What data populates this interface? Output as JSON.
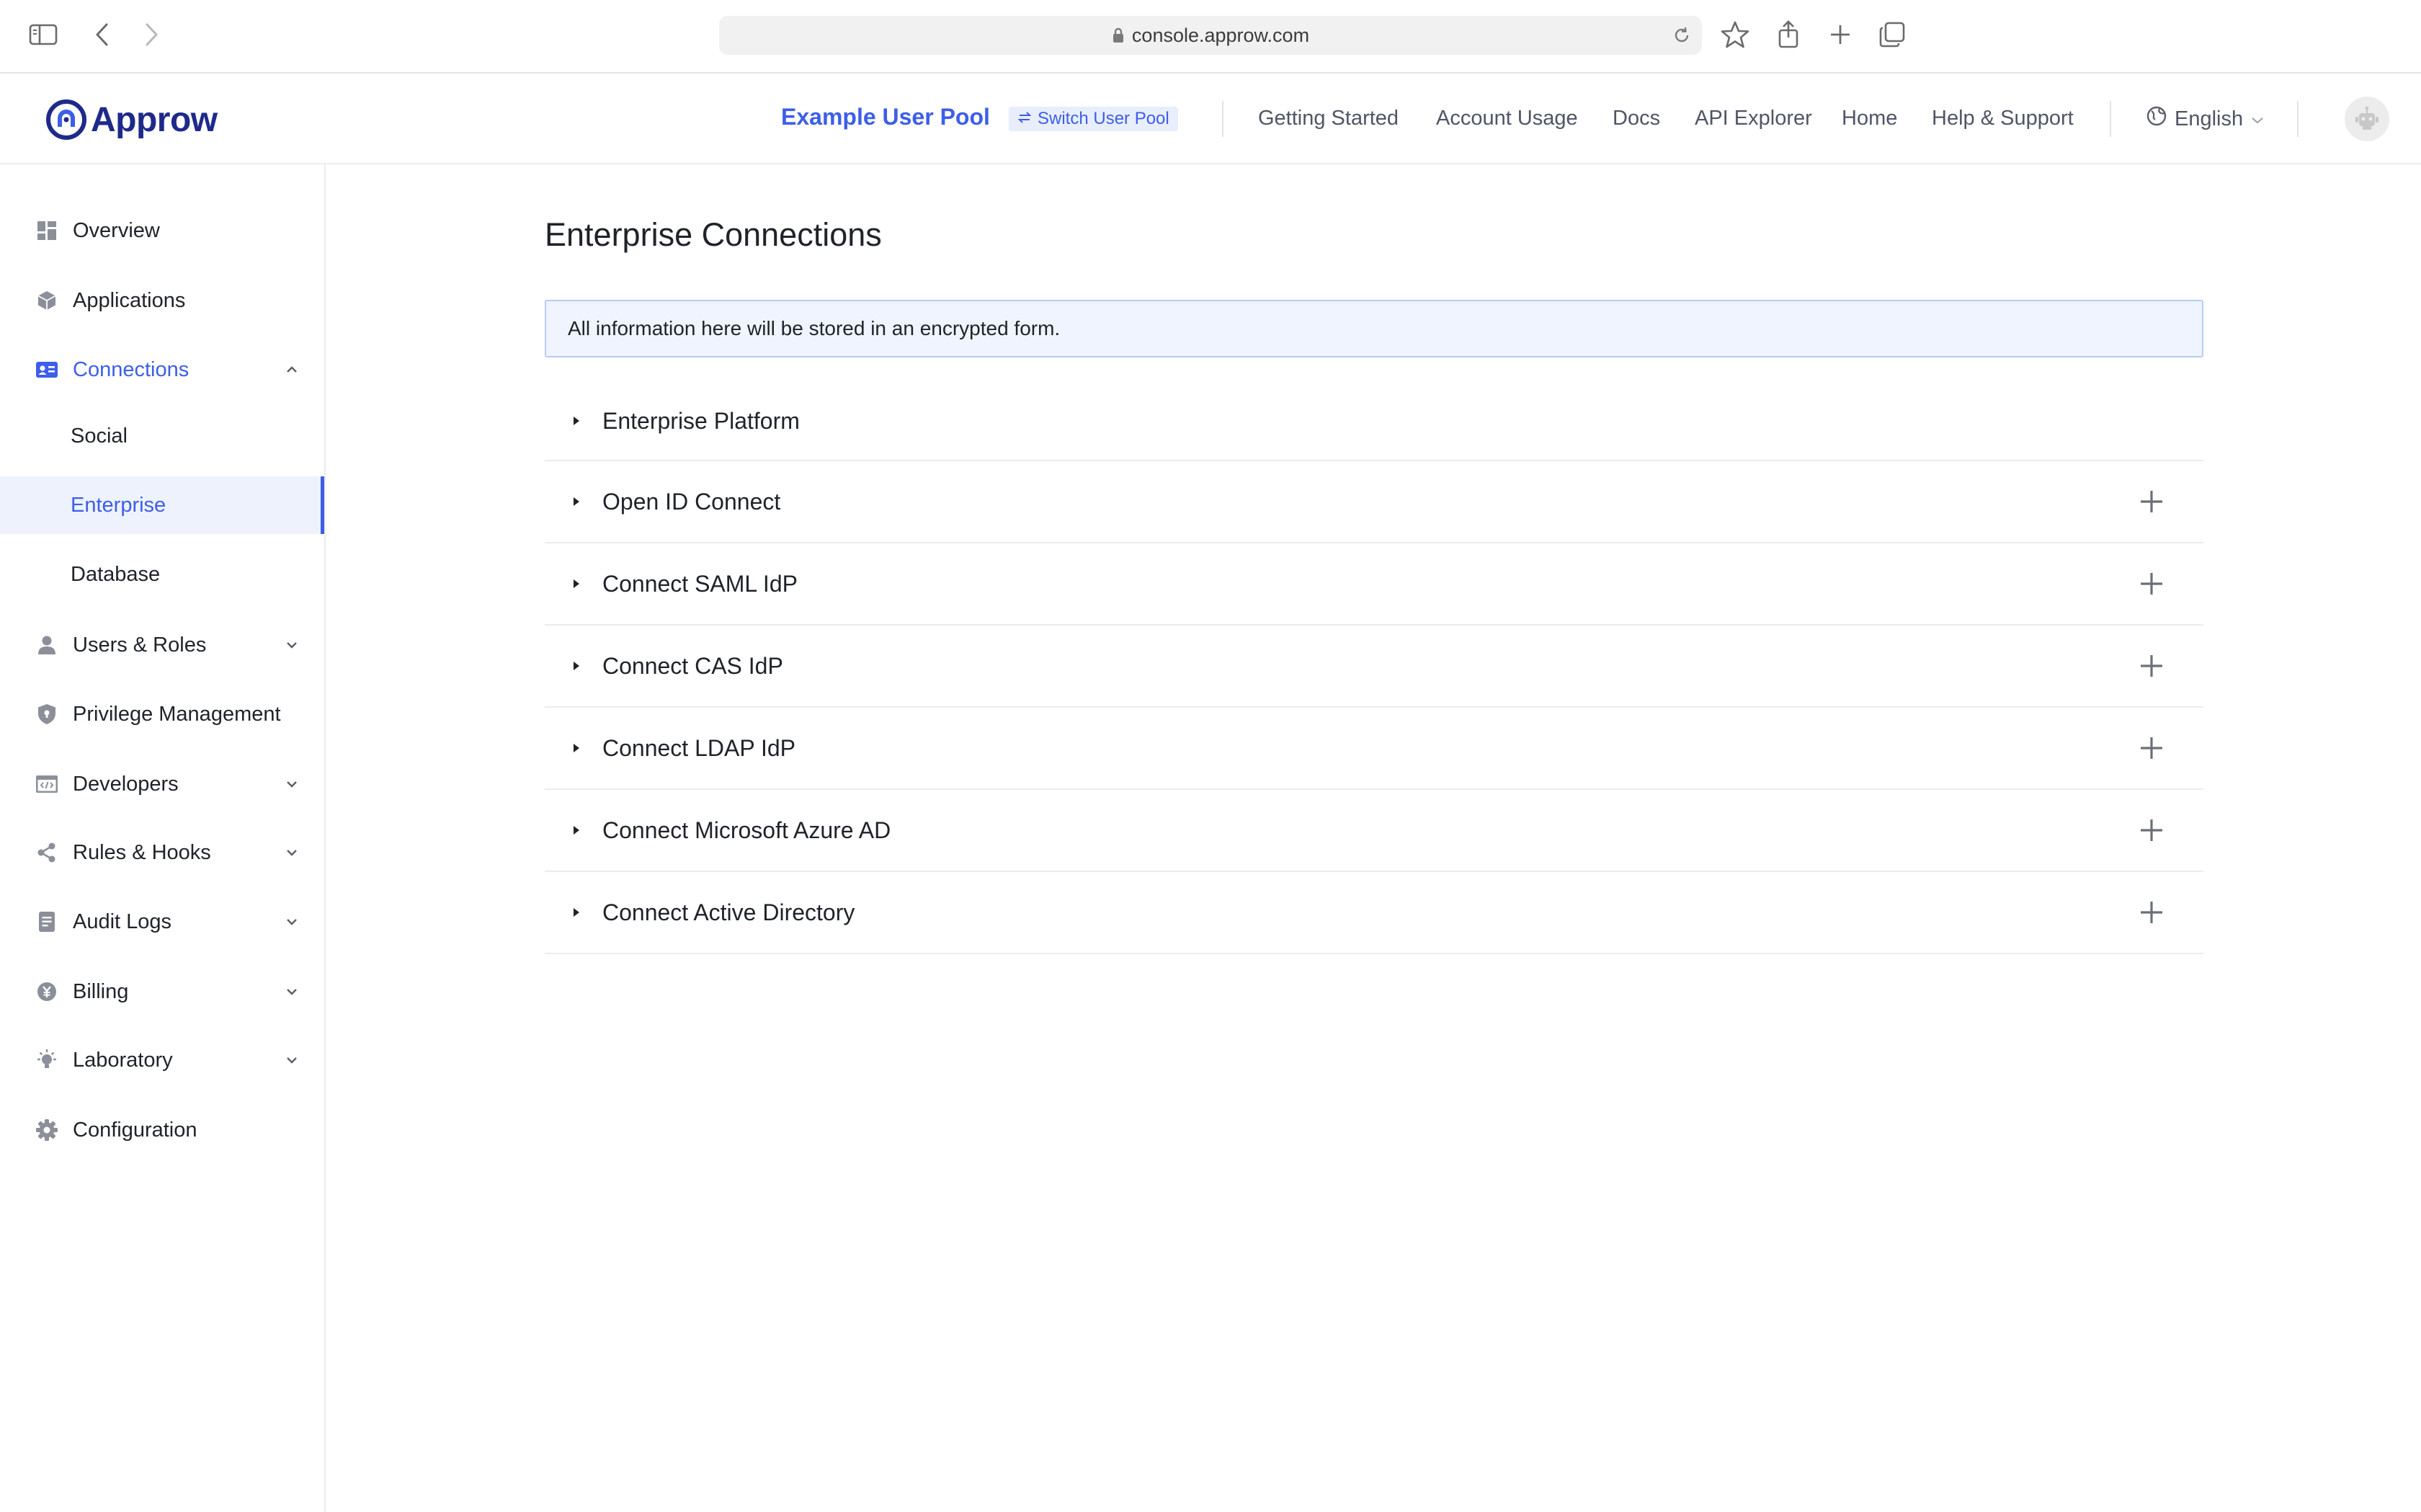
{
  "browser": {
    "url": "console.approw.com"
  },
  "header": {
    "logo_text": "Approw",
    "pool_name": "Example User Pool",
    "switch_pool_label": "Switch User Pool",
    "nav": [
      "Getting Started",
      "Account Usage",
      "Docs",
      "API Explorer",
      "Home",
      "Help & Support"
    ],
    "language": "English"
  },
  "sidebar": {
    "items": [
      {
        "label": "Overview",
        "icon": "dashboard-icon"
      },
      {
        "label": "Applications",
        "icon": "cube-icon"
      },
      {
        "label": "Connections",
        "icon": "id-card-icon",
        "expanded": true
      },
      {
        "label": "Social"
      },
      {
        "label": "Enterprise",
        "selected": true
      },
      {
        "label": "Database"
      },
      {
        "label": "Users & Roles",
        "icon": "user-icon"
      },
      {
        "label": "Privilege Management",
        "icon": "shield-icon"
      },
      {
        "label": "Developers",
        "icon": "code-window-icon"
      },
      {
        "label": "Rules & Hooks",
        "icon": "share-nodes-icon"
      },
      {
        "label": "Audit Logs",
        "icon": "document-icon"
      },
      {
        "label": "Billing",
        "icon": "yen-coin-icon"
      },
      {
        "label": "Laboratory",
        "icon": "bulb-icon"
      },
      {
        "label": "Configuration",
        "icon": "gear-icon"
      }
    ]
  },
  "main": {
    "title": "Enterprise Connections",
    "info": "All information here will be stored in an encrypted form.",
    "connections": [
      {
        "name": "Enterprise Platform",
        "addable": false
      },
      {
        "name": "Open ID Connect",
        "addable": true
      },
      {
        "name": "Connect SAML IdP",
        "addable": true
      },
      {
        "name": "Connect CAS IdP",
        "addable": true
      },
      {
        "name": "Connect LDAP IdP",
        "addable": true
      },
      {
        "name": "Connect Microsoft Azure AD",
        "addable": true
      },
      {
        "name": "Connect Active Directory",
        "addable": true
      }
    ]
  },
  "colors": {
    "accent": "#3d5ee8",
    "logo": "#1e2a8a",
    "banner_bg": "#eff4fe",
    "banner_border": "#b8cbf5"
  }
}
